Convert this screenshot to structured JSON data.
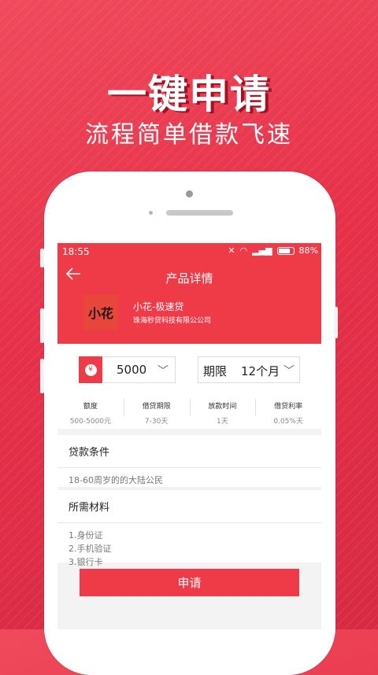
{
  "promo": {
    "headline": "一键申请",
    "subheadline": "流程简单借款飞速"
  },
  "status_bar": {
    "time": "18:55",
    "battery": "88%"
  },
  "nav": {
    "back_icon": "arrow-left-icon",
    "title": "产品详情"
  },
  "product": {
    "logo_text": "小花",
    "name": "小花-极速贷",
    "company": "珠海秒贷科技有限公公司"
  },
  "loan": {
    "currency_symbol": "¥",
    "amount": "5000",
    "term_label": "期限",
    "term_value": "12个月"
  },
  "stats": [
    {
      "label": "额度",
      "value": "500-5000元"
    },
    {
      "label": "借贷期限",
      "value": "7-30天"
    },
    {
      "label": "放款时间",
      "value": "1天"
    },
    {
      "label": "借贷利率",
      "value": "0.05%天"
    }
  ],
  "conditions": {
    "title": "贷款条件",
    "text": "18-60周岁的的大陆公民"
  },
  "materials": {
    "title": "所需材料",
    "items": [
      "1.身份证",
      "2.手机验证",
      "3.银行卡"
    ]
  },
  "apply_button": "申请",
  "colors": {
    "brand_red": "#ee3b47",
    "background_red": "#e63149"
  }
}
